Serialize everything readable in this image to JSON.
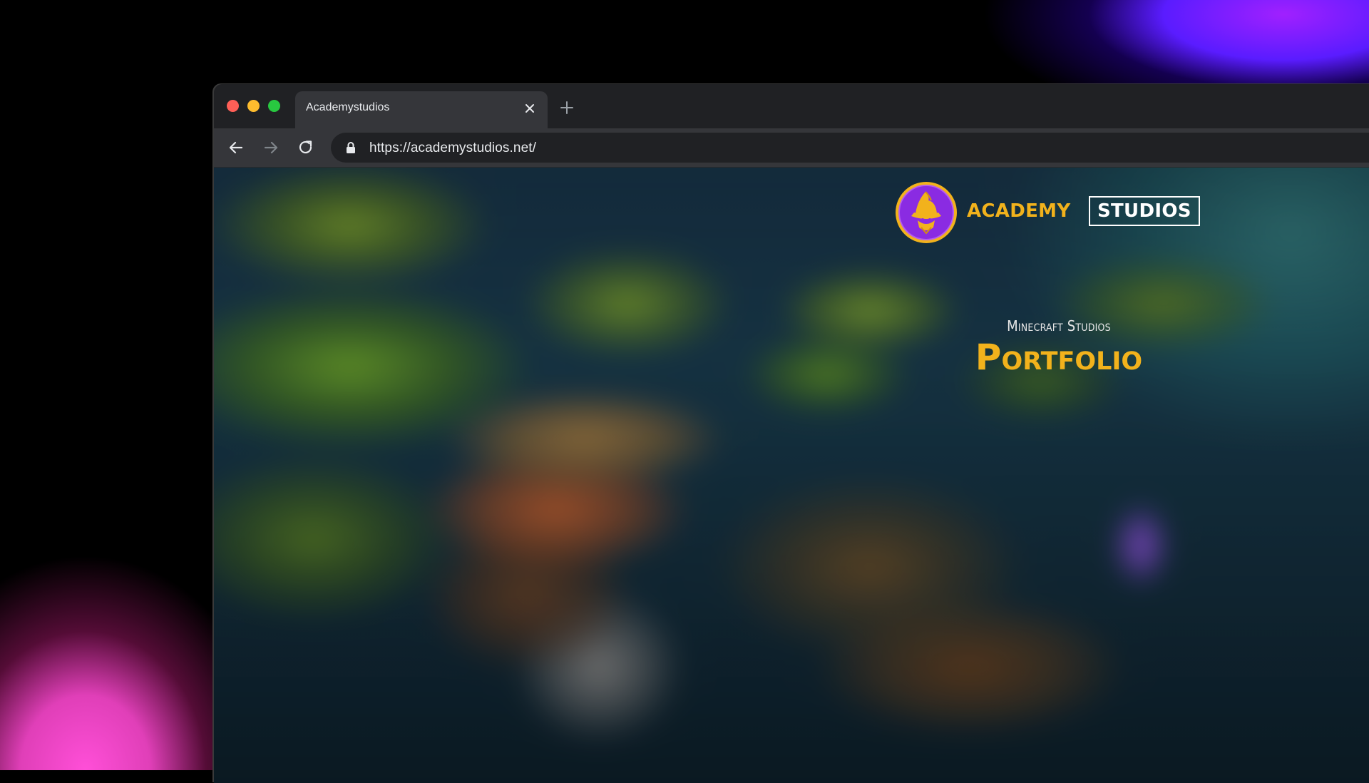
{
  "browser": {
    "tab": {
      "title": "Academystudios"
    },
    "address_bar": {
      "url": "https://academystudios.net/"
    }
  },
  "site": {
    "brand": {
      "academy": "ACADEMY",
      "studios": "STUDIOS"
    },
    "hero": {
      "subtitle": "Minecraft Studios",
      "title": "Portfolio"
    }
  },
  "colors": {
    "brand_gold": "#f2b21c",
    "logo_purple": "#8a2be2",
    "chrome_dark": "#202124",
    "chrome_mid": "#35363a"
  },
  "icons": {
    "close": "close-icon",
    "new_tab": "plus-icon",
    "back": "arrow-left-icon",
    "forward": "arrow-right-icon",
    "reload": "reload-icon",
    "lock": "lock-icon",
    "logo": "wizard-logo-icon"
  }
}
